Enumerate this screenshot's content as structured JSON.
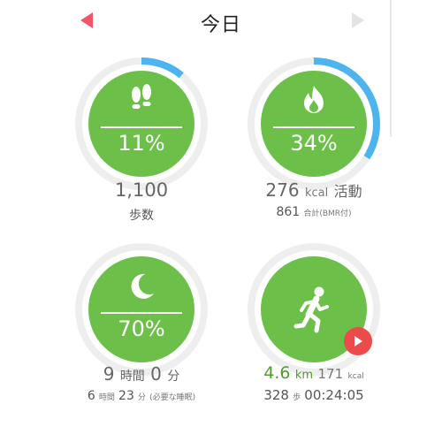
{
  "header": {
    "title": "今日"
  },
  "steps": {
    "percent_label": "11%",
    "progress": 0.11,
    "value": "1,100",
    "label": "歩数"
  },
  "calories": {
    "percent_label": "34%",
    "progress": 0.34,
    "value": "276",
    "unit": "kcal",
    "activity_label": "活動",
    "total": "861",
    "total_label": "合計(BMR付)"
  },
  "sleep": {
    "percent_label": "70%",
    "progress": 0.7,
    "hours": "9",
    "hours_unit": "時間",
    "minutes": "0",
    "minutes_unit": "分",
    "need_hours": "6",
    "need_hours_unit": "時間",
    "need_minutes": "23",
    "need_minutes_unit": "分",
    "need_label": "(必要な睡眠)"
  },
  "exercise": {
    "distance": "4.6",
    "distance_unit": "km",
    "kcal": "171",
    "kcal_unit": "kcal",
    "steps": "328",
    "steps_unit": "歩",
    "duration": "00:24:05"
  },
  "colors": {
    "accent_green": "#6cc04a",
    "progress_blue": "#4db4f0",
    "ring_gray": "#eeeeee",
    "play_red": "#ec4b4b",
    "prev_arrow": "#f0556a"
  },
  "icons": [
    "footsteps-icon",
    "flame-icon",
    "moon-icon",
    "running-person-icon",
    "play-icon"
  ]
}
